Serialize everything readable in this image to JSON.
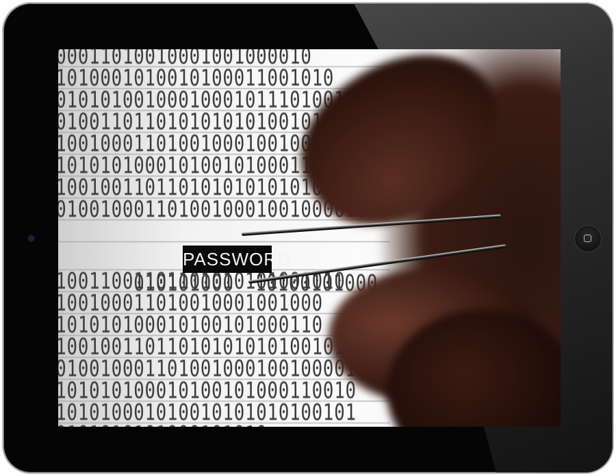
{
  "screen": {
    "binary_rows": [
      "000011010010001001000010",
      "01010001010010100011001010",
      "0010101001000100010111010010",
      "001001101101010101010010101",
      "0100100011010010001001001000",
      "0101010100010100101000110",
      "01001001101101010101010100",
      "0010010001101001000100100001000",
      "",
      "010011001101101010101001010",
      "0100100011010010001001000",
      "0101010100010100101000110",
      "01001001101101010101010010101",
      "00100100011010010001001000010",
      "0101010100010100101000110010",
      "0101010001010010101010100101",
      "00101010101000101010",
      "0"
    ],
    "password_row_left": "010101000",
    "password_row_right": "10100101000",
    "password_label": "PASSWORD"
  }
}
